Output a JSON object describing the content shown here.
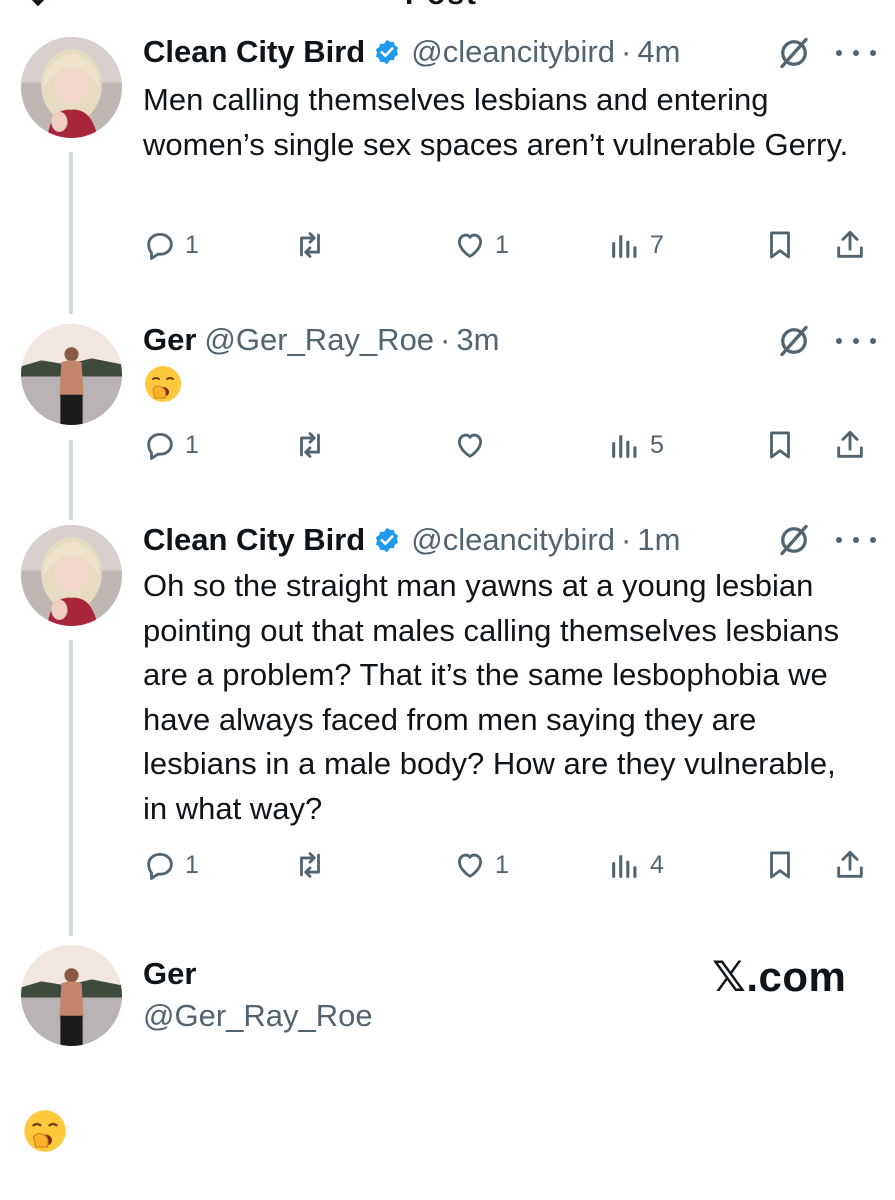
{
  "top": {
    "fragment": "Post"
  },
  "tweets": [
    {
      "name": "Clean City Bird",
      "handle": "@cleancitybird",
      "time": "4m",
      "verified": true,
      "text": "Men calling themselves lesbians and entering women’s single sex spaces aren’t vulnerable Gerry.",
      "replies": "1",
      "reposts": "",
      "likes": "1",
      "views": "7"
    },
    {
      "name": "Ger",
      "handle": "@Ger_Ray_Roe",
      "time": "3m",
      "verified": false,
      "text": "🥱",
      "replies": "1",
      "reposts": "",
      "likes": "",
      "views": "5"
    },
    {
      "name": "Clean City Bird",
      "handle": "@cleancitybird",
      "time": "1m",
      "verified": true,
      "text": "Oh so the straight man yawns at a young lesbian pointing out that males calling themselves lesbians are a problem? That it’s the same lesbophobia we have always faced from men saying they are lesbians in a male body? How are they vulnerable, in what way?",
      "replies": "1",
      "reposts": "",
      "likes": "1",
      "views": "4"
    }
  ],
  "final": {
    "name": "Ger",
    "handle": "@Ger_Ray_Roe",
    "emoji": "🥱"
  },
  "watermark": "𝕏.com",
  "colors": {
    "text": "#0f1419",
    "secondary": "#536471",
    "verified": "#1d9bf0",
    "thread_line": "#cfd9de"
  },
  "icons": [
    "reply-icon",
    "repost-icon",
    "like-icon",
    "views-icon",
    "bookmark-icon",
    "share-icon",
    "grok-icon",
    "more-icon",
    "verified-badge-icon"
  ]
}
